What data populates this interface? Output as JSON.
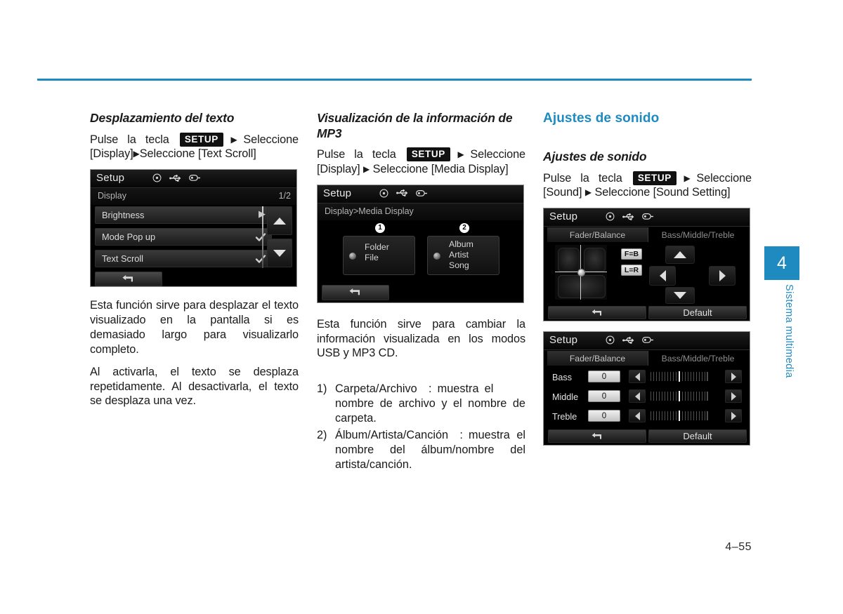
{
  "page": {
    "number": "4–55",
    "side_tab_number": "4",
    "side_tab_label": "Sistema multimedia"
  },
  "col1": {
    "heading": "Desplazamiento del texto",
    "instruction_pre": "Pulse la tecla",
    "instruction_badge": "SETUP",
    "instruction_post": "Seleccione [Display]",
    "instruction_post2": "Seleccione [Text Scroll]",
    "screen": {
      "title": "Setup",
      "breadcrumb": "Display",
      "page_indicator": "1/2",
      "rows": [
        {
          "label": "Brightness",
          "control": "arrow"
        },
        {
          "label": "Mode Pop up",
          "control": "check"
        },
        {
          "label": "Text Scroll",
          "control": "check"
        }
      ],
      "back_icon": "back-arrow-icon",
      "up_icon": "scroll-up-icon",
      "down_icon": "scroll-down-icon",
      "head_icons": [
        "disc-icon",
        "usb-icon",
        "ipod-icon"
      ]
    },
    "para1": "Esta función sirve para desplazar el texto visualizado en la pantalla si es demasiado largo para visualizarlo completo.",
    "para2": "Al activarla, el texto se desplaza repetidamente. Al desactivarla, el texto se desplaza una vez."
  },
  "col2": {
    "heading": "Visualización de la información de MP3",
    "instruction_pre": "Pulse la tecla",
    "instruction_badge": "SETUP",
    "instruction_post": "Seleccione [Display]",
    "instruction_post2": "Seleccione [Media Display]",
    "screen": {
      "title": "Setup",
      "breadcrumb": "Display>Media Display",
      "options": [
        {
          "num": "1",
          "lines": [
            "Folder",
            "File"
          ]
        },
        {
          "num": "2",
          "lines": [
            "Album",
            "Artist",
            "Song"
          ]
        }
      ],
      "back_icon": "back-arrow-icon",
      "head_icons": [
        "disc-icon",
        "usb-icon",
        "ipod-icon"
      ]
    },
    "para1": "Esta función sirve para cambiar la información visualizada en los modos USB y MP3 CD.",
    "list": [
      {
        "marker": "1)",
        "text": "Carpeta/Archivo : muestra el nombre de archivo y el nombre de carpeta."
      },
      {
        "marker": "2)",
        "text": "Álbum/Artista/Canción : muestra el nombre del álbum/nombre del artista/canción."
      }
    ]
  },
  "col3": {
    "section_heading": "Ajustes de sonido",
    "sub_heading": "Ajustes de sonido",
    "instruction_pre": "Pulse la tecla",
    "instruction_badge": "SETUP",
    "instruction_post": "Seleccione [Sound]",
    "instruction_post2": "Seleccione [Sound Setting]",
    "screen_fader": {
      "title": "Setup",
      "tab_selected": "Fader/Balance",
      "tab_unselected": "Bass/Middle/Treble",
      "btn_fb": "F=B",
      "btn_lr": "L=R",
      "back_icon": "back-arrow-icon",
      "default_label": "Default",
      "head_icons": [
        "disc-icon",
        "usb-icon",
        "ipod-icon"
      ],
      "dpad": [
        "up-arrow-icon",
        "left-arrow-icon",
        "right-arrow-icon",
        "down-arrow-icon"
      ]
    },
    "screen_eq": {
      "title": "Setup",
      "tab_unselected": "Fader/Balance",
      "tab_selected": "Bass/Middle/Treble",
      "rows": [
        {
          "label": "Bass",
          "value": "0"
        },
        {
          "label": "Middle",
          "value": "0"
        },
        {
          "label": "Treble",
          "value": "0"
        }
      ],
      "back_icon": "back-arrow-icon",
      "default_label": "Default",
      "head_icons": [
        "disc-icon",
        "usb-icon",
        "ipod-icon"
      ]
    }
  },
  "colors": {
    "accent": "#1f8ac0",
    "rule": "#1f8ac0",
    "screen_bg": "#000000"
  }
}
